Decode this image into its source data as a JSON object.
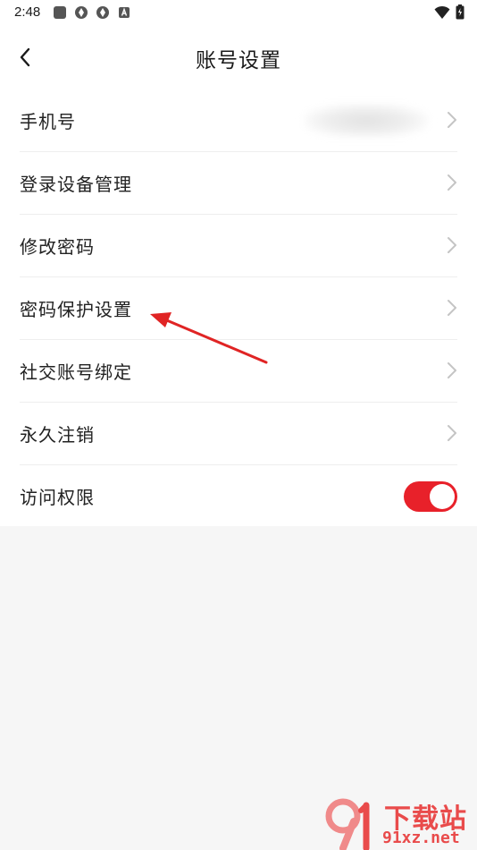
{
  "status_bar": {
    "time": "2:48"
  },
  "header": {
    "title": "账号设置"
  },
  "settings": {
    "items": [
      {
        "label": "手机号"
      },
      {
        "label": "登录设备管理"
      },
      {
        "label": "修改密码"
      },
      {
        "label": "密码保护设置"
      },
      {
        "label": "社交账号绑定"
      },
      {
        "label": "永久注销"
      },
      {
        "label": "访问权限",
        "toggle_on": true
      }
    ]
  },
  "colors": {
    "accent": "#e8212a",
    "arrow": "#e02424",
    "watermark": "#e94b4b"
  },
  "icons": {
    "back": "chevron-left-icon",
    "row": "chevron-right-icon"
  },
  "watermark": {
    "title": "下载站",
    "subtitle": "91xz.net"
  }
}
